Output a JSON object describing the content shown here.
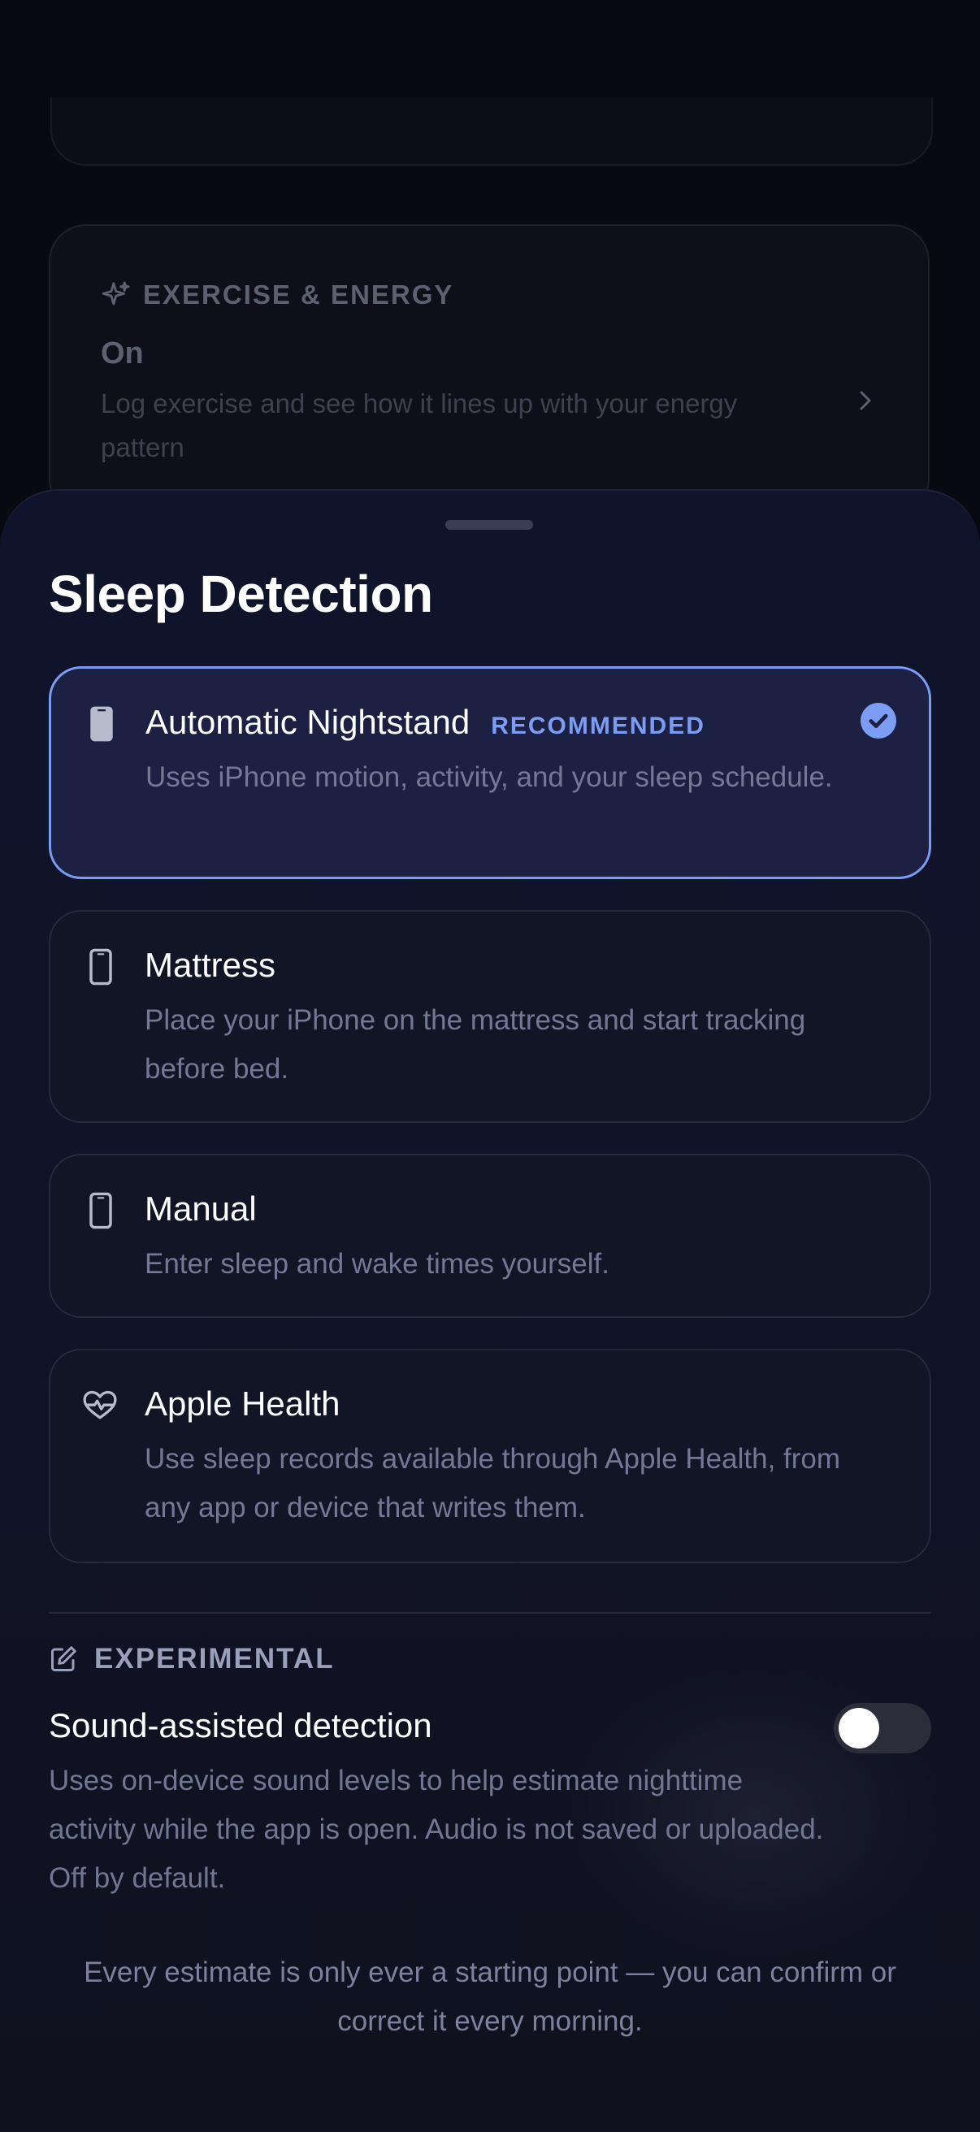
{
  "background_card": {
    "eyebrow": "EXERCISE & ENERGY",
    "status": "On",
    "description": "Log exercise and see how it lines up with your energy pattern"
  },
  "sheet": {
    "title": "Sleep Detection",
    "options": [
      {
        "title": "Automatic Nightstand",
        "badge": "RECOMMENDED",
        "description": "Uses iPhone motion, activity, and your sleep schedule.",
        "icon": "phone-icon",
        "selected": true
      },
      {
        "title": "Mattress",
        "description": "Place your iPhone on the mattress and start tracking before bed.",
        "icon": "phone-outline-icon",
        "selected": false
      },
      {
        "title": "Manual",
        "description": "Enter sleep and wake times yourself.",
        "icon": "phone-outline-icon",
        "selected": false
      },
      {
        "title": "Apple Health",
        "description": "Use sleep records available through Apple Health, from any app or device that writes them.",
        "icon": "heart-pulse-icon",
        "selected": false
      }
    ],
    "experimental": {
      "heading": "EXPERIMENTAL",
      "title": "Sound-assisted detection",
      "description": "Uses on-device sound levels to help estimate nighttime activity while the app is open. Audio is not saved or uploaded. Off by default.",
      "toggle_on": false
    },
    "footer": "Every estimate is only ever a starting point — you can confirm or correct it every morning."
  },
  "colors": {
    "accent": "#7c9cf3",
    "sheet_bg": "#111429",
    "selected_bg": "#1c2043"
  }
}
